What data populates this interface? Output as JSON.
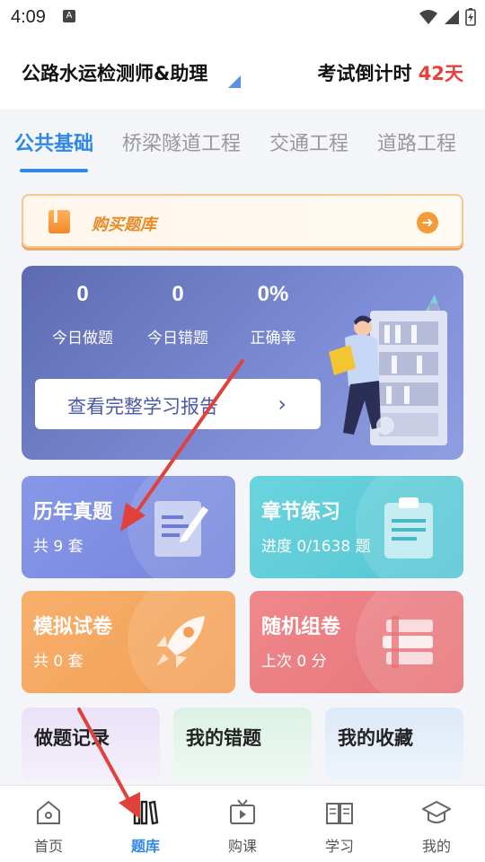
{
  "status": {
    "time": "4:09",
    "indicator": "A"
  },
  "header": {
    "exam_name": "公路水运检测师&助理",
    "countdown_label": "考试倒计时",
    "countdown_days": "42天"
  },
  "tabs": [
    {
      "label": "公共基础",
      "active": true
    },
    {
      "label": "桥梁隧道工程",
      "active": false
    },
    {
      "label": "交通工程",
      "active": false
    },
    {
      "label": "道路工程",
      "active": false
    }
  ],
  "buy_banner": {
    "label": "购买题库",
    "icon": "book-icon",
    "arrow_icon": "arrow-right-icon"
  },
  "stats": {
    "items": [
      {
        "value": "0",
        "label": "今日做题"
      },
      {
        "value": "0",
        "label": "今日错题"
      },
      {
        "value": "0%",
        "label": "正确率"
      }
    ],
    "report_label": "查看完整学习报告"
  },
  "tiles": [
    {
      "title": "历年真题",
      "subtitle": "共 9 套",
      "color": "#7f8ee3",
      "icon": "pen-notebook-icon"
    },
    {
      "title": "章节练习",
      "subtitle": "进度 0/1638 题",
      "color": "#5cccd6",
      "icon": "clipboard-icon"
    },
    {
      "title": "模拟试卷",
      "subtitle": "共 0 套",
      "color": "#f4a45e",
      "icon": "rocket-icon"
    },
    {
      "title": "随机组卷",
      "subtitle": "上次 0 分",
      "color": "#ea7b80",
      "icon": "books-stack-icon"
    }
  ],
  "small_tiles": [
    {
      "title": "做题记录",
      "color": "#e6dbf6"
    },
    {
      "title": "我的错题",
      "color": "#dbf1e4"
    },
    {
      "title": "我的收藏",
      "color": "#dde9f7"
    }
  ],
  "bottom_nav": [
    {
      "label": "首页",
      "icon": "home-icon",
      "active": false
    },
    {
      "label": "题库",
      "icon": "library-icon",
      "active": true
    },
    {
      "label": "购课",
      "icon": "tv-play-icon",
      "active": false
    },
    {
      "label": "学习",
      "icon": "open-book-icon",
      "active": false
    },
    {
      "label": "我的",
      "icon": "graduation-cap-icon",
      "active": false
    }
  ],
  "colors": {
    "accent": "#2f88e6",
    "countdown": "#e9403b",
    "annotation_arrow": "#e0413a"
  }
}
